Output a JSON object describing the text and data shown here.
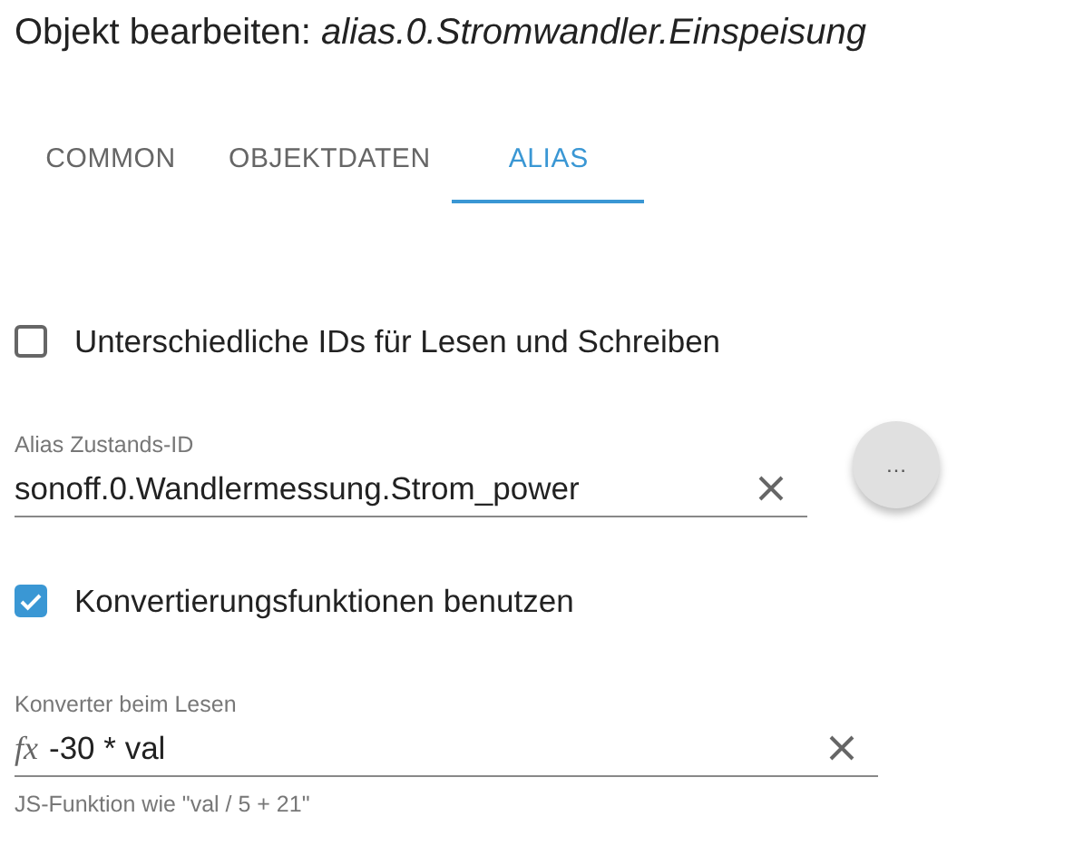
{
  "dialog": {
    "title": "Objekt bearbeiten: *alias.0.Stromwandler.Einspeisung*"
  },
  "tabs": [
    {
      "label": "COMMON",
      "selected": false
    },
    {
      "label": "OBJEKTDATEN",
      "selected": false
    },
    {
      "label": "ALIAS",
      "selected": true
    }
  ],
  "form": [
    {
      "kind": "checkbox",
      "label": "Unterschiedliche IDs für Lesen und Schreiben",
      "checked": false
    },
    {
      "kind": "field",
      "label": "Alias Zustands-ID",
      "value": "sonoff.0.Wandlermessung.Strom_power",
      "button": "…"
    },
    {
      "kind": "checkbox",
      "label": "Konvertierungsfunktionen benutzen",
      "checked": true
    },
    {
      "kind": "field",
      "label": "Konverter beim Lesen",
      "prefix": "fx",
      "value": "-30 * val",
      "helper": "JS-Funktion wie \"val / 5 + 21\""
    }
  ]
}
